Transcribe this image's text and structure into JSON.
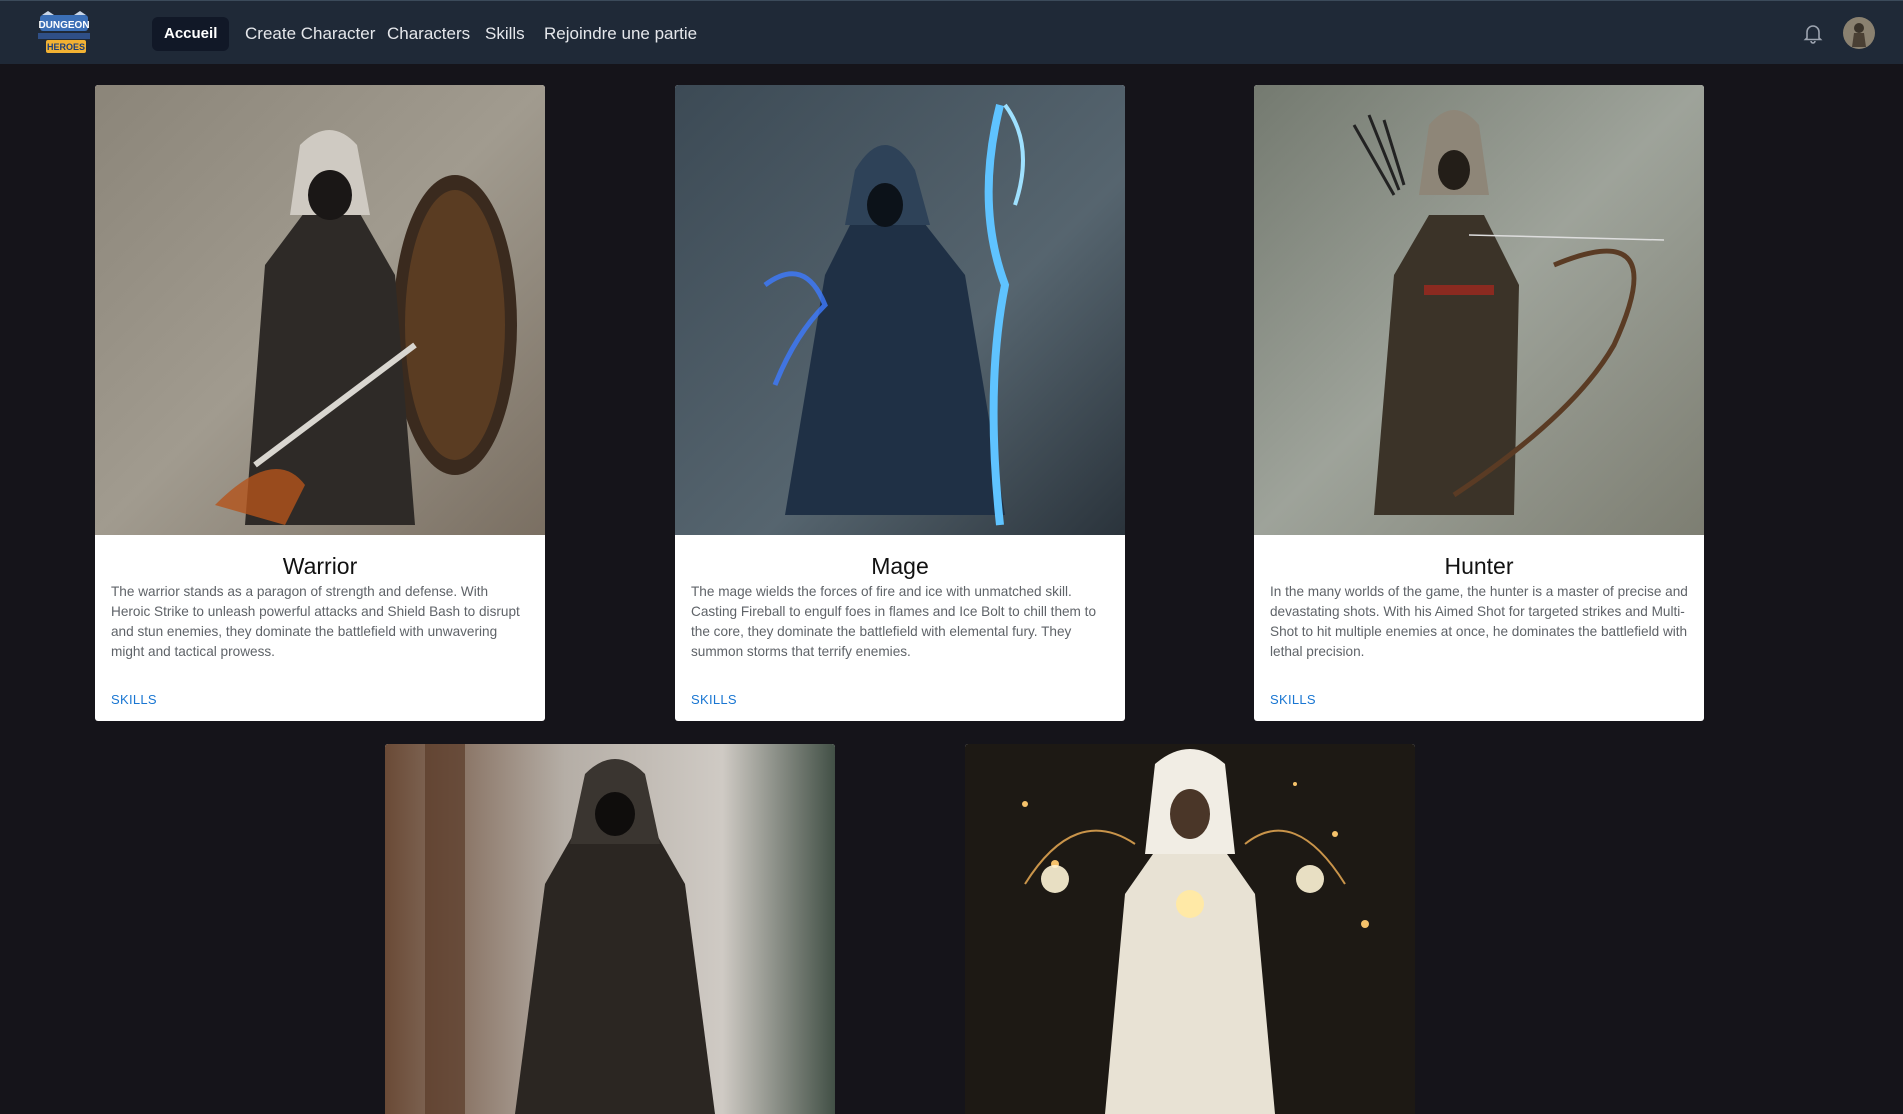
{
  "header": {
    "logo_text": "DUNGEON HEROES",
    "nav": [
      {
        "label": "Accueil",
        "active": true
      },
      {
        "label": "Create Character"
      },
      {
        "label": "Characters"
      },
      {
        "label": "Skills"
      },
      {
        "label": "Rejoindre une partie"
      }
    ],
    "icons": {
      "notifications": "bell-icon",
      "user": "avatar"
    }
  },
  "classes": [
    {
      "name": "Warrior",
      "description": "The warrior stands as a paragon of strength and defense. With Heroic Strike to unleash powerful attacks and Shield Bash to disrupt and stun enemies, they dominate the battlefield with unwavering might and tactical prowess.",
      "action": "SKILLS"
    },
    {
      "name": "Mage",
      "description": "The mage wields the forces of fire and ice with unmatched skill. Casting Fireball to engulf foes in flames and Ice Bolt to chill them to the core, they dominate the battlefield with elemental fury. They summon storms that terrify enemies.",
      "action": "SKILLS"
    },
    {
      "name": "Hunter",
      "description": "In the many worlds of the game, the hunter is a master of precise and devastating shots. With his Aimed Shot for targeted strikes and Multi-Shot to hit multiple enemies at once, he dominates the battlefield with lethal precision.",
      "action": "SKILLS"
    }
  ],
  "colors": {
    "background": "#15141a",
    "navbar": "#1f2937",
    "link": "#1976d2"
  }
}
